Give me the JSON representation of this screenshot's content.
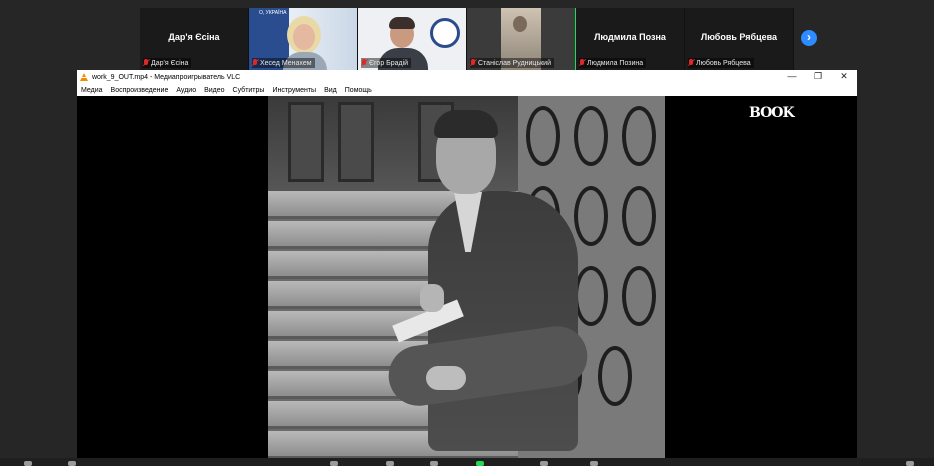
{
  "participants": [
    {
      "big_name": "Дар'я Єсіна",
      "caption": "Дар'я Єсіна",
      "muted": true,
      "video": false,
      "active": false
    },
    {
      "big_name": "",
      "caption": "Хесед Менахем",
      "muted": true,
      "video": true,
      "active": false,
      "banner_text": "О, УКРАЇНА"
    },
    {
      "big_name": "",
      "caption": "Єгор Брадій",
      "muted": true,
      "video": true,
      "active": false
    },
    {
      "big_name": "",
      "caption": "Станіслав Рудницький",
      "muted": true,
      "video": true,
      "active": true
    },
    {
      "big_name": "Людмила  Позна",
      "caption": "Людмила Позина",
      "muted": true,
      "video": false,
      "active": false
    },
    {
      "big_name": "Любовь Рябцева",
      "caption": "Любовь Рябцева",
      "muted": true,
      "video": false,
      "active": false
    }
  ],
  "strip": {
    "next_icon": "chevron-right-icon",
    "next_glyph": "›"
  },
  "vlc": {
    "title": "work_9_OUT.mp4 - Медиапроигрыватель VLC",
    "window_controls": {
      "minimize": "—",
      "maximize": "❐",
      "close": "✕"
    },
    "menu": [
      "Медиа",
      "Воспроизведение",
      "Аудио",
      "Видео",
      "Субтитры",
      "Инструменты",
      "Вид",
      "Помощь"
    ],
    "video_logo": "BOOK"
  },
  "colors": {
    "active_speaker": "#23d959",
    "muted": "#e02828",
    "accent": "#2d8cff",
    "vlc_cone": "#f48b00"
  }
}
